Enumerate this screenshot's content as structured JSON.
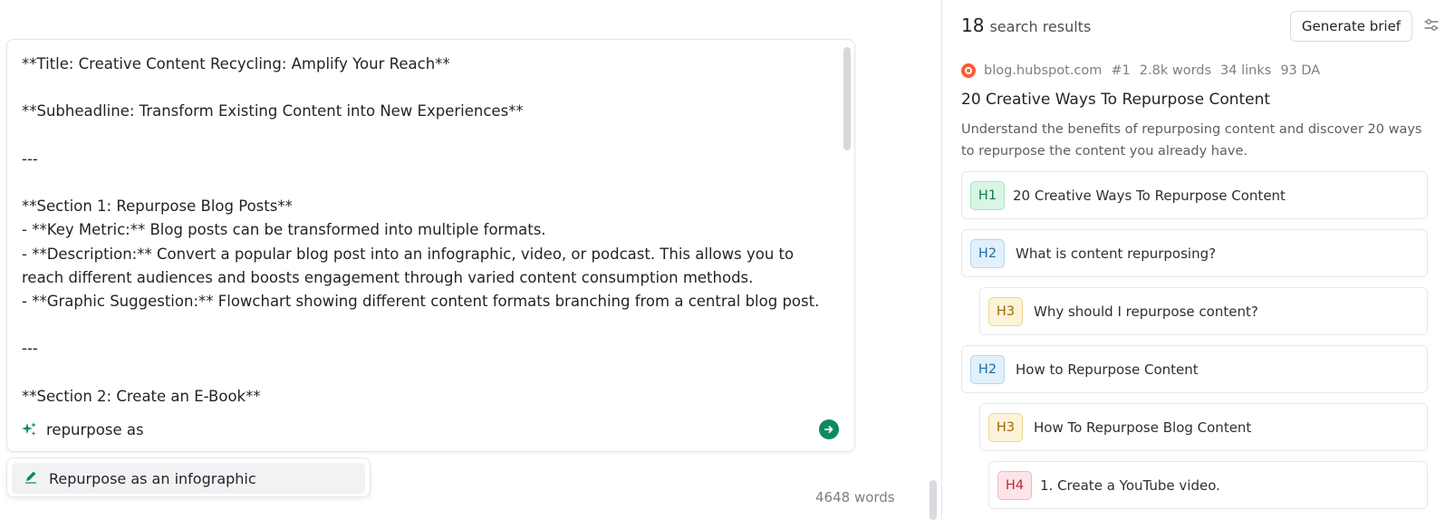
{
  "editor": {
    "lines": [
      "**Title: Creative Content Recycling: Amplify Your Reach**",
      "",
      "**Subheadline: Transform Existing Content into New Experiences**",
      "",
      "---",
      "",
      "**Section 1: Repurpose Blog Posts**",
      "- **Key Metric:** Blog posts can be transformed into multiple formats.",
      "- **Description:** Convert a popular blog post into an infographic, video, or podcast. This allows you to",
      "reach different audiences and boosts engagement through varied content consumption methods.",
      "- **Graphic Suggestion:** Flowchart showing different content formats branching from a central blog post.",
      "",
      "---",
      "",
      "**Section 2: Create an E-Book**"
    ],
    "prompt_value": "repurpose as",
    "suggestion": "Repurpose as an infographic",
    "word_count": "4648 words"
  },
  "results": {
    "count": "18",
    "label": "search results",
    "generate_button": "Generate brief",
    "source": {
      "domain": "blog.hubspot.com",
      "rank": "#1",
      "words": "2.8k words",
      "links": "34 links",
      "da": "93 DA"
    },
    "title": "20 Creative Ways To Repurpose Content",
    "description": "Understand the benefits of repurposing content and discover 20 ways to repurpose the content you already have.",
    "outline": [
      {
        "tag": "H1",
        "text": "20 Creative Ways To Repurpose Content"
      },
      {
        "tag": "H2",
        "text": "What is content repurposing?"
      },
      {
        "tag": "H3",
        "text": "Why should I repurpose content?"
      },
      {
        "tag": "H2",
        "text": "How to Repurpose Content"
      },
      {
        "tag": "H3",
        "text": "How To Repurpose Blog Content"
      },
      {
        "tag": "H4",
        "text": "1. Create a YouTube video."
      }
    ]
  },
  "icons": {
    "prompt": "sparkle-icon",
    "send": "arrow-right-circle-icon",
    "suggestion": "pencil-icon",
    "settings": "sliders-icon",
    "source": "hubspot-logo-icon"
  },
  "colors": {
    "accent": "#0e8a5f",
    "hubspot": "#ff5c35"
  }
}
